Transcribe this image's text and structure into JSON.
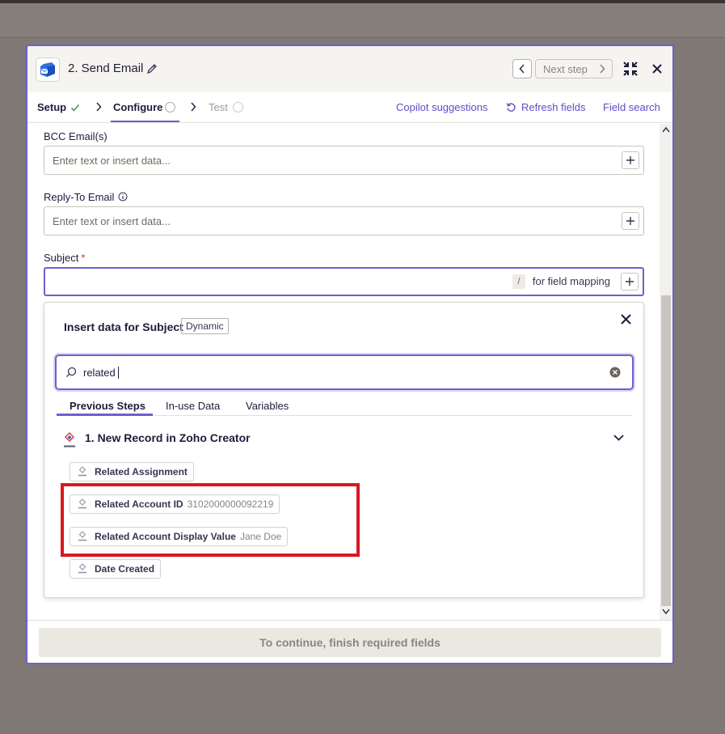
{
  "header": {
    "step_title": "2. Send Email",
    "next_step_label": "Next step"
  },
  "tabs": {
    "setup": "Setup",
    "configure": "Configure",
    "test": "Test"
  },
  "links": {
    "copilot": "Copilot suggestions",
    "refresh": "Refresh fields",
    "field_search": "Field search"
  },
  "fields": {
    "bcc_label": "BCC Email(s)",
    "bcc_placeholder": "Enter text or insert data...",
    "reply_to_label": "Reply-To Email",
    "reply_to_placeholder": "Enter text or insert data...",
    "subject_label": "Subject",
    "subject_required": "*",
    "slash_key": "/",
    "subject_hint": "for field mapping"
  },
  "dropdown": {
    "title": "Insert data for Subject",
    "badge": "Dynamic",
    "search_value": "related",
    "tabs": [
      "Previous Steps",
      "In-use Data",
      "Variables"
    ],
    "group_title": "1.  New Record in Zoho Creator",
    "items": [
      {
        "label": "Related Assignment",
        "value": ""
      },
      {
        "label": "Related Account ID",
        "value": "3102000000092219"
      },
      {
        "label": "Related Account Display Value",
        "value": "Jane Doe"
      },
      {
        "label": "Date Created",
        "value": ""
      }
    ]
  },
  "footer": {
    "continue_label": "To continue, finish required fields"
  },
  "colors": {
    "accent": "#6b5fd3",
    "highlight": "#d91920",
    "required": "#d3391f",
    "check": "#3f9e4f"
  },
  "icons": {
    "app": "email-app-icon",
    "source": "zoho-creator-icon"
  }
}
